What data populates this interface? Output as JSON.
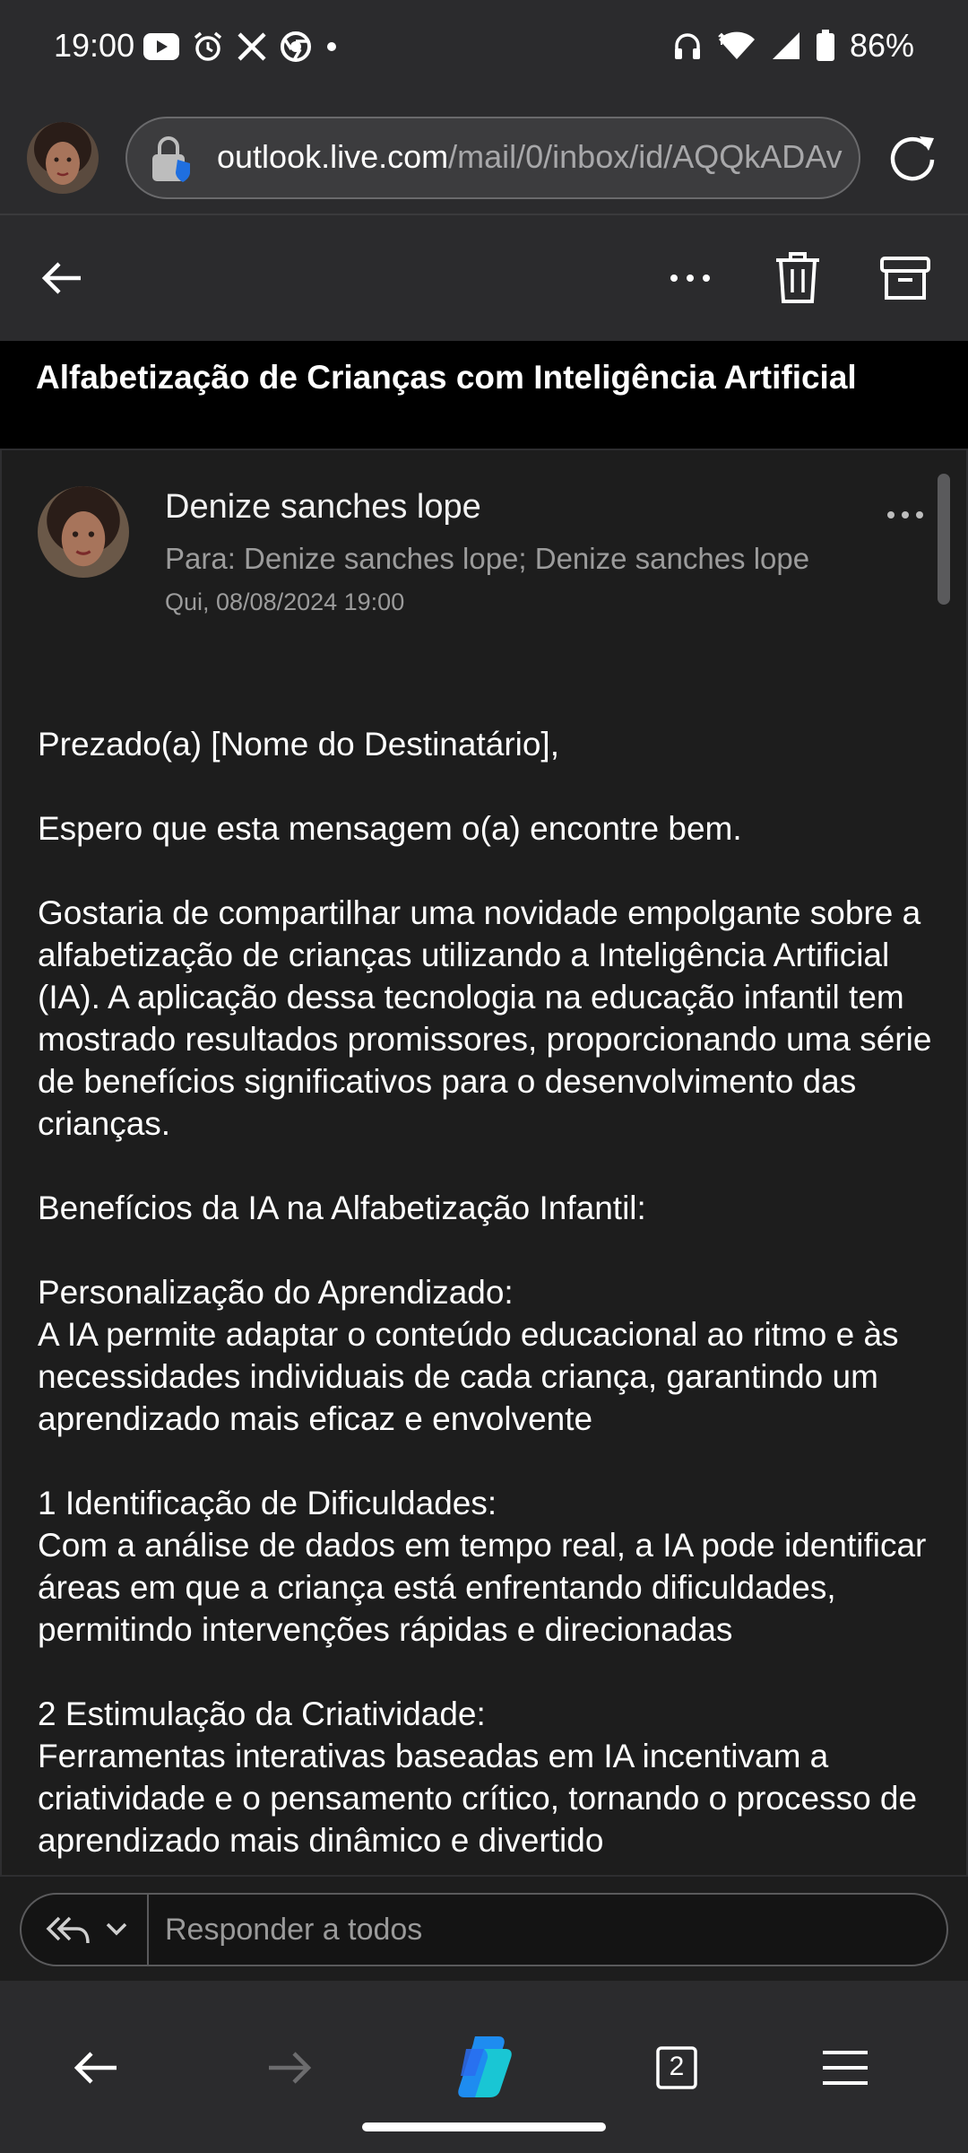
{
  "status_bar": {
    "time": "19:00",
    "battery": "86%",
    "icons_left": [
      "youtube-icon",
      "alarm-icon",
      "x-icon",
      "chrome-icon",
      "dot-icon"
    ],
    "icons_right": [
      "headphones-icon",
      "wifi-icon",
      "signal-icon",
      "battery-icon"
    ]
  },
  "browser": {
    "url_host": "outlook.live.com",
    "url_path": "/mail/0/inbox/id/AQQkADAv",
    "tab_count": "2"
  },
  "mail": {
    "subject": "Alfabetização de Crianças com Inteligência Artificial",
    "sender": "Denize sanches lope",
    "recipients": "Para: Denize sanches lope;  Denize sanches lope",
    "date": "Qui, 08/08/2024 19:00",
    "body": [
      "Prezado(a) [Nome do Destinatário],",
      "Espero que esta mensagem o(a) encontre bem.",
      "Gostaria de compartilhar uma novidade empolgante sobre a alfabetização de crianças utilizando a Inteligência Artificial (IA). A aplicação dessa tecnologia na educação infantil tem mostrado resultados promissores, proporcionando uma série de benefícios significativos para o desenvolvimento das crianças.",
      "Benefícios da IA na Alfabetização Infantil:",
      "Personalização do Aprendizado:",
      "A IA permite adaptar o conteúdo educacional ao ritmo e às necessidades individuais de cada criança, garantindo um aprendizado mais eficaz e envolvente",
      "1 Identificação de Dificuldades:",
      "Com a análise de dados em tempo real, a IA pode identificar áreas em que a criança está enfrentando dificuldades, permitindo intervenções rápidas e direcionadas",
      "2 Estimulação da Criatividade:",
      "Ferramentas interativas baseadas em IA incentivam a criatividade e o pensamento crítico, tornando o processo de aprendizado mais dinâmico e divertido"
    ]
  },
  "reply": {
    "placeholder": "Responder a todos"
  },
  "colors": {
    "chrome_bg": "#2b2b2d",
    "pane_bg": "#1d1d1d",
    "muted_text": "#9c9c9c"
  }
}
